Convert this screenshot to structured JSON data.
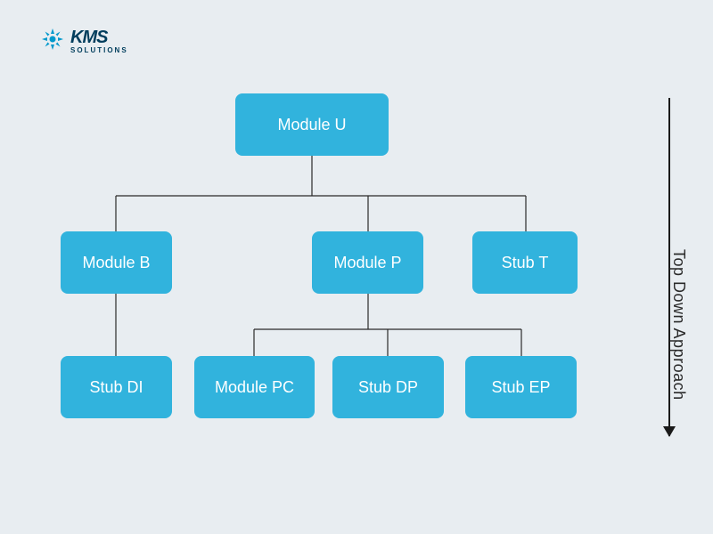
{
  "logo": {
    "main": "KMS",
    "sub": "SOLUTIONS"
  },
  "nodes": {
    "root": "Module U",
    "b": "Module B",
    "p": "Module P",
    "t": "Stub T",
    "di": "Stub DI",
    "pc": "Module PC",
    "dp": "Stub DP",
    "ep": "Stub EP"
  },
  "side_label": "Top Down Approach",
  "colors": {
    "node_bg": "#31b3dd",
    "body_bg": "#e8edf1",
    "text_dark": "#003d5c"
  },
  "chart_data": {
    "type": "tree",
    "title": "Top Down Approach",
    "direction": "top-down",
    "root": {
      "name": "Module U",
      "children": [
        {
          "name": "Module B",
          "children": [
            {
              "name": "Stub DI"
            }
          ]
        },
        {
          "name": "Module P",
          "children": [
            {
              "name": "Module PC"
            },
            {
              "name": "Stub DP"
            },
            {
              "name": "Stub EP"
            }
          ]
        },
        {
          "name": "Stub T"
        }
      ]
    }
  }
}
